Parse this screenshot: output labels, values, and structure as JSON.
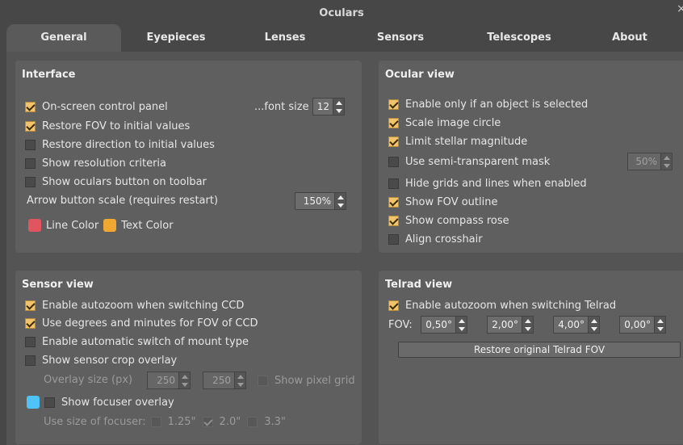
{
  "window": {
    "title": "Oculars",
    "close": "×"
  },
  "tabs": [
    "General",
    "Eyepieces",
    "Lenses",
    "Sensors",
    "Telescopes",
    "About"
  ],
  "interface": {
    "title": "Interface",
    "items": [
      {
        "label": "On-screen control panel",
        "checked": true
      },
      {
        "label": "Restore FOV to initial values",
        "checked": true
      },
      {
        "label": "Restore direction to initial values",
        "checked": false
      },
      {
        "label": "Show resolution criteria",
        "checked": false
      },
      {
        "label": "Show oculars button on toolbar",
        "checked": false
      }
    ],
    "font_size_label": "...font size",
    "font_size_value": "12",
    "arrow_scale_label": "Arrow button scale (requires restart)",
    "arrow_scale_value": "150%",
    "line_color_label": "Line Color",
    "text_color_label": "Text Color",
    "line_color": "#e05560",
    "text_color": "#f0a830"
  },
  "ocular_view": {
    "title": "Ocular view",
    "items": [
      {
        "label": "Enable only if an object is selected",
        "checked": true
      },
      {
        "label": "Scale image circle",
        "checked": true
      },
      {
        "label": "Limit stellar magnitude",
        "checked": true
      },
      {
        "label": "Use semi-transparent mask",
        "checked": false
      },
      {
        "label": "Hide grids and lines when enabled",
        "checked": false
      },
      {
        "label": "Show FOV outline",
        "checked": true
      },
      {
        "label": "Show compass rose",
        "checked": true
      },
      {
        "label": "Align crosshair",
        "checked": false
      }
    ],
    "mask_value": "50%"
  },
  "sensor_view": {
    "title": "Sensor view",
    "items": [
      {
        "label": "Enable autozoom when switching CCD",
        "checked": true
      },
      {
        "label": "Use degrees and minutes for FOV of CCD",
        "checked": true
      },
      {
        "label": "Enable automatic switch of mount type",
        "checked": false
      },
      {
        "label": "Show sensor crop overlay",
        "checked": false
      }
    ],
    "overlay_size_label": "Overlay size (px)",
    "overlay_w": "250",
    "overlay_h": "250",
    "show_pixel_grid_label": "Show pixel grid",
    "focuser_label": "Show focuser overlay",
    "focuser_color": "#4fc3f7",
    "focuser_size_label": "Use size of focuser:",
    "focuser_sizes": [
      {
        "label": "1.25\"",
        "checked": false
      },
      {
        "label": "2.0\"",
        "checked": true
      },
      {
        "label": "3.3\"",
        "checked": false
      }
    ]
  },
  "telrad_view": {
    "title": "Telrad view",
    "autozoom_label": "Enable autozoom when switching Telrad",
    "fov_label": "FOV:",
    "fov_values": [
      "0,50°",
      "2,00°",
      "4,00°",
      "0,00°"
    ],
    "restore_button": "Restore original Telrad FOV"
  }
}
